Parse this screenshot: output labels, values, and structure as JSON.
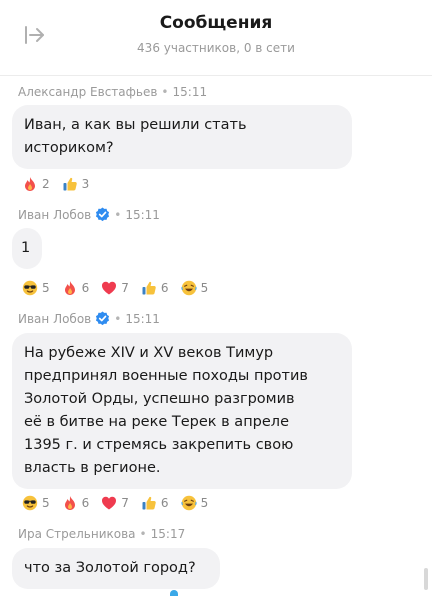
{
  "header": {
    "title": "Сообщения",
    "subtitle": "436 участников, 0 в сети"
  },
  "messages": [
    {
      "author": "Александр Евстафьев",
      "sep": "•",
      "time": "15:11",
      "lines": [
        "Иван, а как вы решили стать",
        "историком?"
      ],
      "reactions": [
        {
          "icon": "fire-icon",
          "count": "2"
        },
        {
          "icon": "thumbs-up-icon",
          "count": "3"
        }
      ]
    },
    {
      "author": "Иван Лобов",
      "verified": true,
      "sep": "•",
      "time": "15:11",
      "lines": [
        "1"
      ],
      "reactions": [
        {
          "icon": "sunglasses-icon",
          "count": "5"
        },
        {
          "icon": "fire-icon",
          "count": "6"
        },
        {
          "icon": "heart-icon",
          "count": "7"
        },
        {
          "icon": "thumbs-up-icon",
          "count": "6"
        },
        {
          "icon": "laughing-icon",
          "count": "5"
        }
      ]
    },
    {
      "author": "Иван Лобов",
      "verified": true,
      "sep": "•",
      "time": "15:11",
      "lines": [
        "На рубеже XIV и XV веков Тимур",
        "предпринял военные походы против",
        "Золотой Орды, успешно разгромив",
        "её в битве на реке Терек в апреле",
        "1395 г. и стремясь закрепить свою",
        "власть в регионе."
      ],
      "reactions": [
        {
          "icon": "sunglasses-icon",
          "count": "5"
        },
        {
          "icon": "fire-icon",
          "count": "6"
        },
        {
          "icon": "heart-icon",
          "count": "7"
        },
        {
          "icon": "thumbs-up-icon",
          "count": "6"
        },
        {
          "icon": "laughing-icon",
          "count": "5"
        }
      ]
    },
    {
      "author": "Ира Стрельникова",
      "sep": "•",
      "time": "15:17",
      "lines": [
        "что за Золотой город?"
      ],
      "reactions": []
    }
  ],
  "colors": {
    "bubble": "#f2f2f4",
    "verified": "#2f8cf0",
    "meta": "#9a9a9a"
  }
}
